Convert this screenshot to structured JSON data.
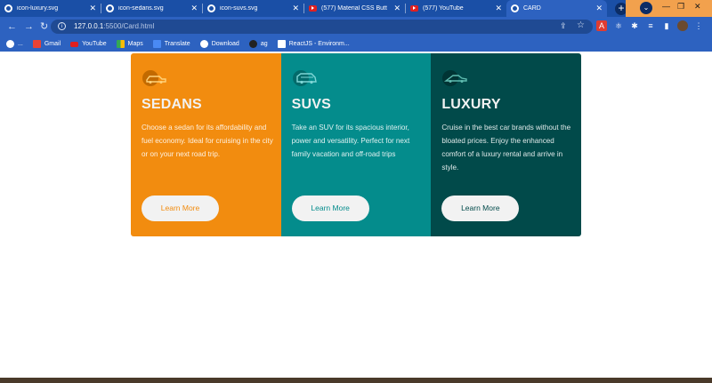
{
  "browser": {
    "tabs": [
      {
        "title": "icon-luxury.svg",
        "favicon": "globe-icon",
        "active": false
      },
      {
        "title": "icon-sedans.svg",
        "favicon": "globe-icon",
        "active": false
      },
      {
        "title": "icon-suvs.svg",
        "favicon": "globe-icon",
        "active": false
      },
      {
        "title": "(577) Material CSS Butt",
        "favicon": "youtube-icon",
        "active": false
      },
      {
        "title": "(577) YouTube",
        "favicon": "youtube-icon",
        "active": false
      },
      {
        "title": "CARD",
        "favicon": "globe-icon",
        "active": true
      }
    ],
    "new_tab_label": "+",
    "address": {
      "host": "127.0.0.1",
      "path": ":5500/Card.html"
    },
    "bookmarks": [
      {
        "label": "...",
        "icon": "globe-icon"
      },
      {
        "label": "Gmail",
        "icon": "gmail-icon"
      },
      {
        "label": "YouTube",
        "icon": "youtube-icon"
      },
      {
        "label": "Maps",
        "icon": "maps-icon"
      },
      {
        "label": "Translate",
        "icon": "translate-icon"
      },
      {
        "label": "Download",
        "icon": "download-icon"
      },
      {
        "label": "ag",
        "icon": "ag-icon"
      },
      {
        "label": "ReactJS - Environm...",
        "icon": "react-icon"
      }
    ],
    "colors": {
      "tabbar": "#1a4fa6",
      "toolbar": "#2d62c0",
      "accent": "#f2a14d"
    }
  },
  "cards": [
    {
      "title": "SEDANS",
      "description": "Choose a sedan for its affordability and fuel economy. Ideal for cruising in the city or on your next road trip.",
      "button": "Learn More",
      "icon": "sedan-car-icon",
      "color": "#f28c0f"
    },
    {
      "title": "SUVS",
      "description": "Take an SUV for its spacious interior, power and versatility. Perfect for next family vacation and off-road trips",
      "button": "Learn More",
      "icon": "suv-car-icon",
      "color": "#048c8c"
    },
    {
      "title": "LUXURY",
      "description": "Cruise in the best car brands without the bloated prices. Enjoy the enhanced comfort of a luxury rental and arrive in style.",
      "button": "Learn More",
      "icon": "luxury-car-icon",
      "color": "#014a4a"
    }
  ]
}
